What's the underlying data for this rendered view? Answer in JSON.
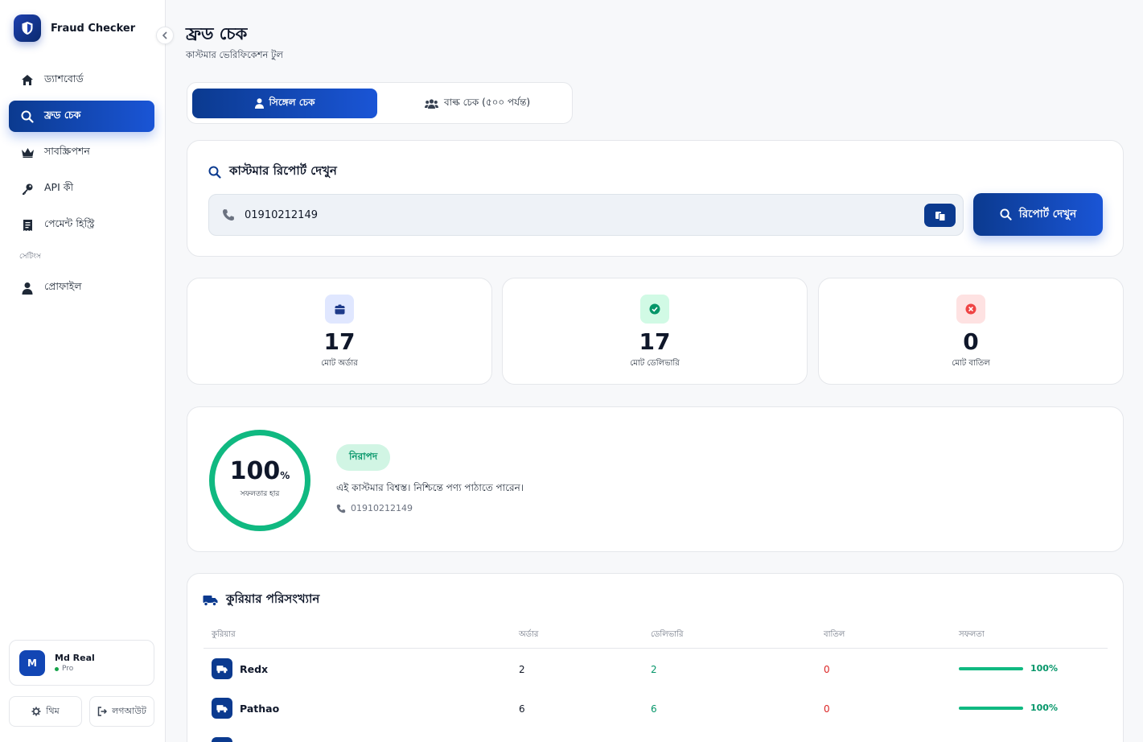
{
  "brand": {
    "name": "Fraud Checker"
  },
  "sidebar": {
    "items": [
      {
        "label": "ড্যাশবোর্ড",
        "icon": "home-icon"
      },
      {
        "label": "ফ্রড চেক",
        "icon": "search-icon",
        "active": true
      },
      {
        "label": "সাবস্ক্রিপশন",
        "icon": "crown-icon"
      },
      {
        "label": "API কী",
        "icon": "key-icon"
      },
      {
        "label": "পেমেন্ট হিস্ট্রি",
        "icon": "receipt-icon"
      }
    ],
    "section_label": "সেটিংস",
    "settings_items": [
      {
        "label": "প্রোফাইল",
        "icon": "user-icon"
      }
    ],
    "user": {
      "initial": "M",
      "name": "Md Real",
      "plan": "Pro"
    },
    "theme_label": "থিম",
    "logout_label": "লগআউট"
  },
  "header": {
    "title": "ফ্রড চেক",
    "subtitle": "কাস্টমার ভেরিফিকেশন টুল"
  },
  "tabs": {
    "single": "সিঙ্গেল চেক",
    "bulk": "বাল্ক চেক (৫০০ পর্যন্ত)"
  },
  "search": {
    "title": "কাস্টমার রিপোর্ট দেখুন",
    "value": "01910212149",
    "button": "রিপোর্ট দেখুন"
  },
  "stats": [
    {
      "value": "17",
      "label": "মোট অর্ডার",
      "icon": "box-icon",
      "bg": "#e0e7ff",
      "fg": "#1e3a8a"
    },
    {
      "value": "17",
      "label": "মোট ডেলিভারি",
      "icon": "check-circle-icon",
      "bg": "#d1fae5",
      "fg": "#059669"
    },
    {
      "value": "0",
      "label": "মোট বাতিল",
      "icon": "x-circle-icon",
      "bg": "#fee2e2",
      "fg": "#ef4444"
    }
  ],
  "rate": {
    "value": "100",
    "unit": "%",
    "fraction": 1.0,
    "label": "সফলতার হার",
    "badge": "নিরাপদ",
    "message": "এই কাস্টমার বিশ্বস্ত। নিশ্চিন্তে পণ্য পাঠাতে পারেন।",
    "phone": "01910212149",
    "color": "#10b981"
  },
  "courier": {
    "title": "কুরিয়ার পরিসংখ্যান",
    "headers": [
      "কুরিয়ার",
      "অর্ডার",
      "ডেলিভারি",
      "বাতিল",
      "সফলতা"
    ],
    "rows": [
      {
        "name": "Redx",
        "orders": "2",
        "delivered": "2",
        "cancelled": "0",
        "success": "100%"
      },
      {
        "name": "Pathao",
        "orders": "6",
        "delivered": "6",
        "cancelled": "0",
        "success": "100%"
      }
    ]
  }
}
